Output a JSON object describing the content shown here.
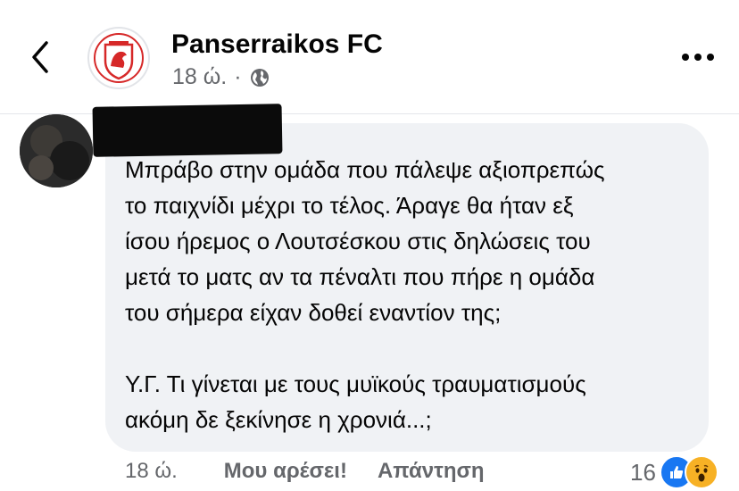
{
  "header": {
    "page_name": "Panserraikos FC",
    "time": "18 ώ.",
    "separator": "·",
    "back_icon": "chevron-left-icon",
    "privacy_icon": "globe-icon",
    "more_icon": "more-dots-icon"
  },
  "comment": {
    "lines_p1": [
      "Μπράβο στην ομάδα που πάλεψε αξιοπρεπώς",
      "το παιχνίδι μέχρι το τέλος. Άραγε θα ήταν εξ",
      "ίσου ήρεμος ο Λουτσέσκου στις δηλώσεις του",
      "μετά το ματς αν τα πέναλτι που πήρε η ομάδα",
      "του σήμερα είχαν δοθεί εναντίον της;"
    ],
    "lines_p2": [
      "Υ.Γ. Τι γίνεται με τους μυϊκούς τραυματισμούς",
      "ακόμη δε ξεκίνησε η χρονιά...;"
    ]
  },
  "actions": {
    "time": "18 ώ.",
    "like_label": "Μου αρέσει!",
    "reply_label": "Απάντηση",
    "reaction_count": "16",
    "reaction_icons": [
      "like-icon",
      "wow-icon"
    ]
  },
  "colors": {
    "bubble": "#f0f2f5",
    "meta_text": "#65676b",
    "like_blue": "#1877f2",
    "wow_yellow": "#f7b125",
    "crest_red": "#d62828"
  }
}
